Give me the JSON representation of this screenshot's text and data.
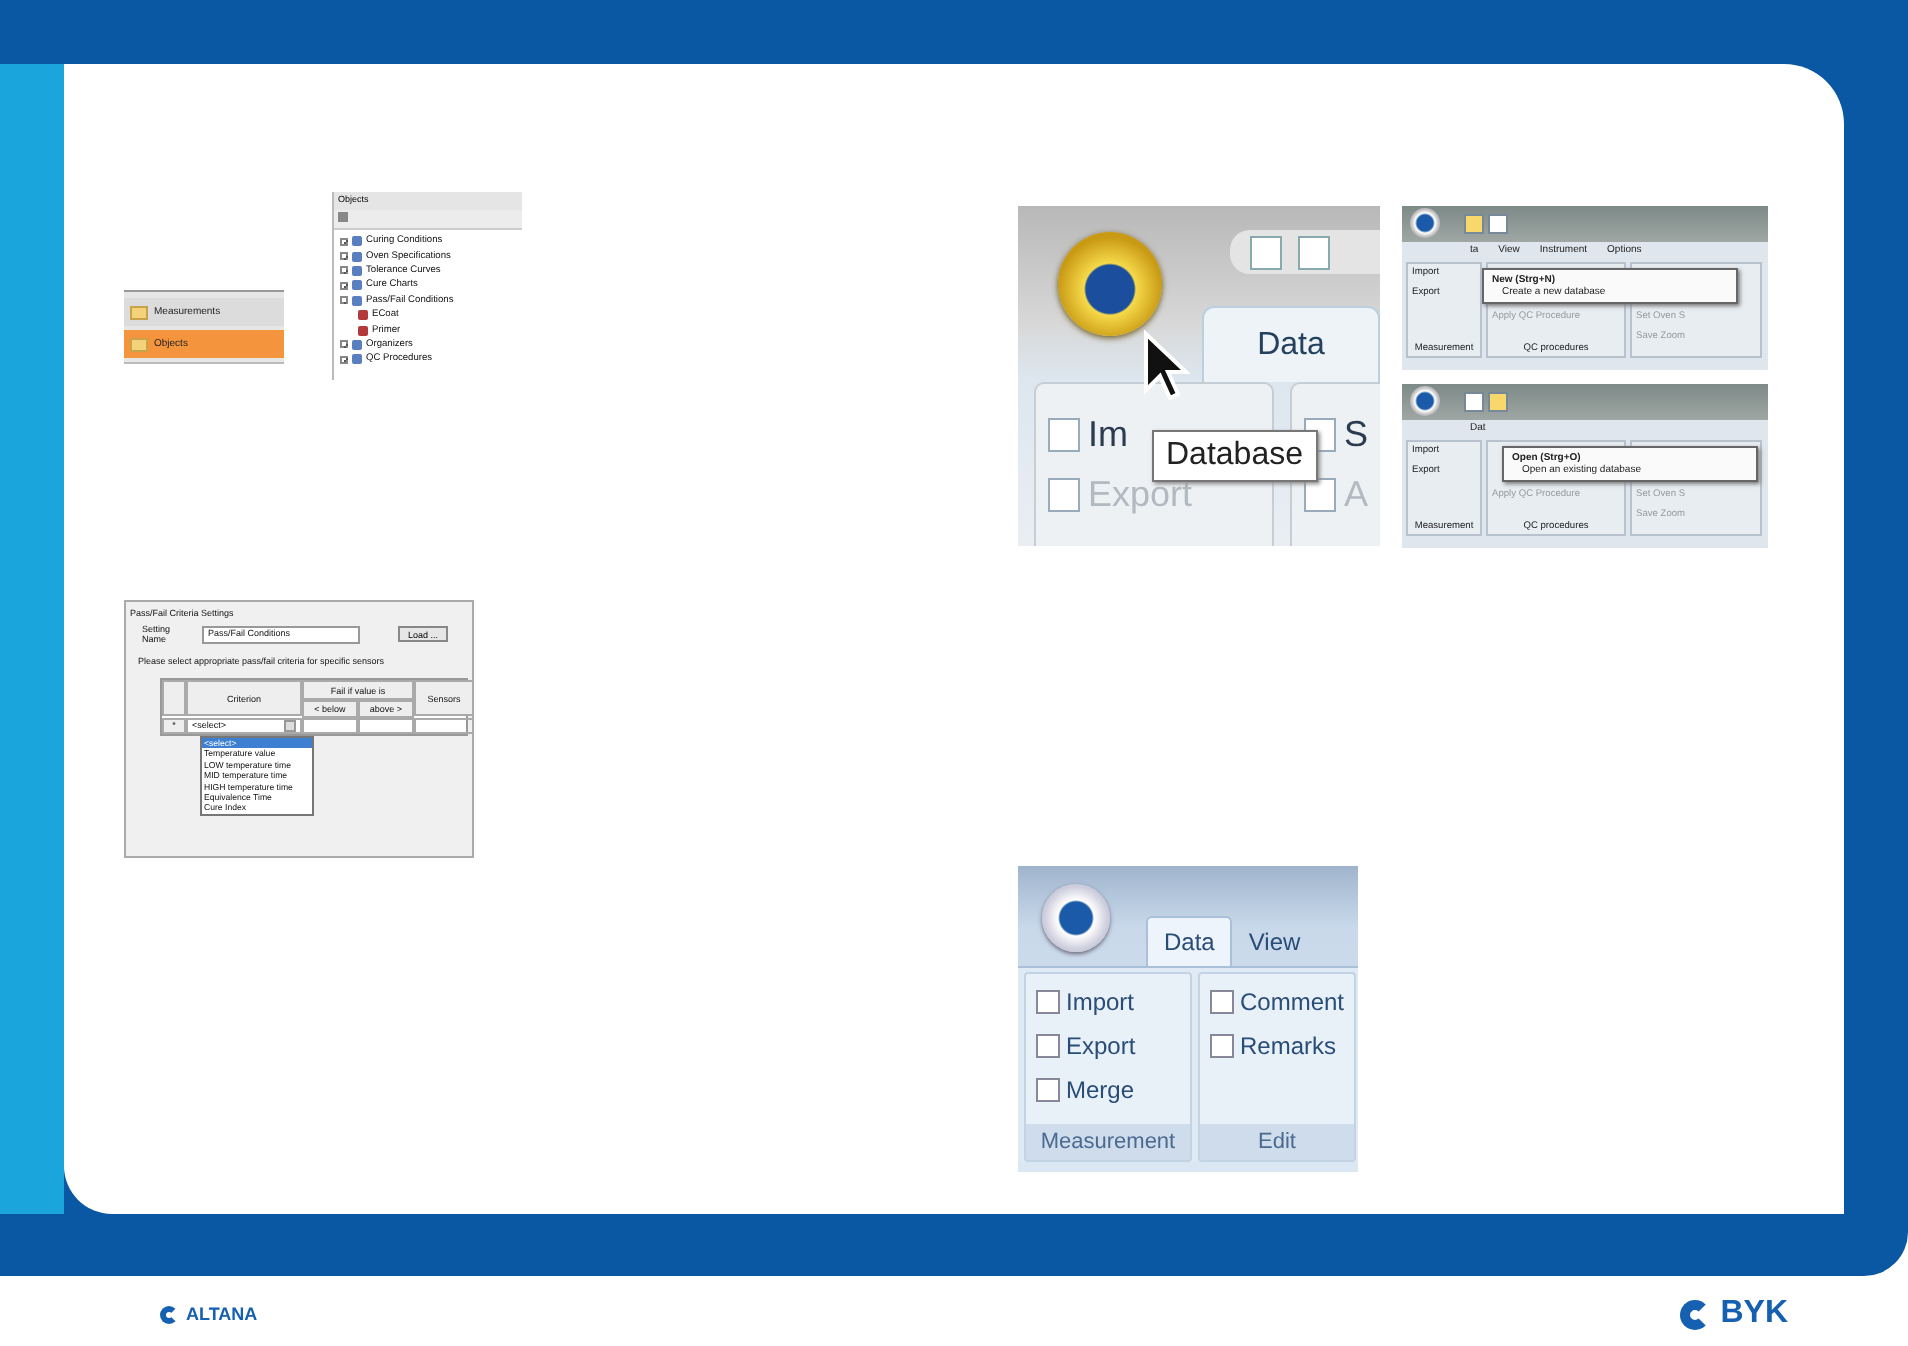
{
  "nav_panel": {
    "items": [
      {
        "label": "Measurements",
        "selected": false
      },
      {
        "label": "Objects",
        "selected": true
      }
    ]
  },
  "objects_tree": {
    "title": "Objects",
    "items": [
      {
        "label": "Curing Conditions",
        "expanded": false
      },
      {
        "label": "Oven Specifications",
        "expanded": false
      },
      {
        "label": "Tolerance Curves",
        "expanded": false
      },
      {
        "label": "Cure Charts",
        "expanded": false
      },
      {
        "label": "Pass/Fail Conditions",
        "expanded": true,
        "children": [
          {
            "label": "ECoat"
          },
          {
            "label": "Primer"
          }
        ]
      },
      {
        "label": "Organizers",
        "expanded": false
      },
      {
        "label": "QC Procedures",
        "expanded": false
      }
    ]
  },
  "pass_fail": {
    "title": "Pass/Fail Criteria Settings",
    "setting_name_label": "Setting Name",
    "setting_name_value": "Pass/Fail Conditions",
    "load_button": "Load ...",
    "instruction": "Please select appropriate pass/fail criteria for specific sensors",
    "columns": {
      "criterion": "Criterion",
      "fail_group": "Fail if value is",
      "below": "< below",
      "above": "above >",
      "sensors": "Sensors"
    },
    "row": {
      "marker": "*",
      "criterion": "<select>"
    },
    "options": [
      {
        "label": "<select>",
        "selected": true
      },
      {
        "label": "Temperature value",
        "selected": false
      },
      {
        "label": "LOW temperature time",
        "selected": false
      },
      {
        "label": "MID temperature time",
        "selected": false
      },
      {
        "label": "HIGH temperature time",
        "selected": false
      },
      {
        "label": "Equivalence Time",
        "selected": false
      },
      {
        "label": "Cure Index",
        "selected": false
      }
    ]
  },
  "database_closeup": {
    "tab": "Data",
    "buttons": [
      "Im",
      "Export"
    ],
    "buttons_right": [
      "S",
      "A"
    ],
    "tooltip": "Database"
  },
  "menu_shots": [
    {
      "tabs": [
        "ta",
        "View",
        "Instrument",
        "Options"
      ],
      "menu_title": "New (Strg+N)",
      "menu_text": "Create a new database",
      "buttons": [
        "Import",
        "Export"
      ],
      "qc_buttons": [
        "Apply QC Procedure"
      ],
      "right_buttons": [
        "Set Oven S",
        "Save Zoom"
      ],
      "groups": [
        "Measurement",
        "QC procedures"
      ],
      "quick_icons": [
        {
          "highlighted": true
        },
        {
          "highlighted": false
        }
      ]
    },
    {
      "tabs": [
        "Dat"
      ],
      "menu_title": "Open (Strg+O)",
      "menu_text": "Open an existing database",
      "buttons": [
        "Import",
        "Export"
      ],
      "qc_buttons": [
        "Apply QC Procedure"
      ],
      "right_buttons": [
        "Set Oven S",
        "Save Zoom"
      ],
      "groups": [
        "Measurement",
        "QC procedures"
      ],
      "quick_icons": [
        {
          "highlighted": false
        },
        {
          "highlighted": true
        }
      ]
    }
  ],
  "ribbon": {
    "tabs": [
      {
        "label": "Data",
        "selected": true
      },
      {
        "label": "View",
        "selected": false
      }
    ],
    "groups": [
      {
        "label": "Measurement",
        "buttons": [
          "Import",
          "Export",
          "Merge"
        ]
      },
      {
        "label": "Edit",
        "buttons": [
          "Comment",
          "Remarks"
        ]
      }
    ]
  },
  "footer": {
    "left_logo": "ALTANA",
    "right_logo": "BYK"
  }
}
